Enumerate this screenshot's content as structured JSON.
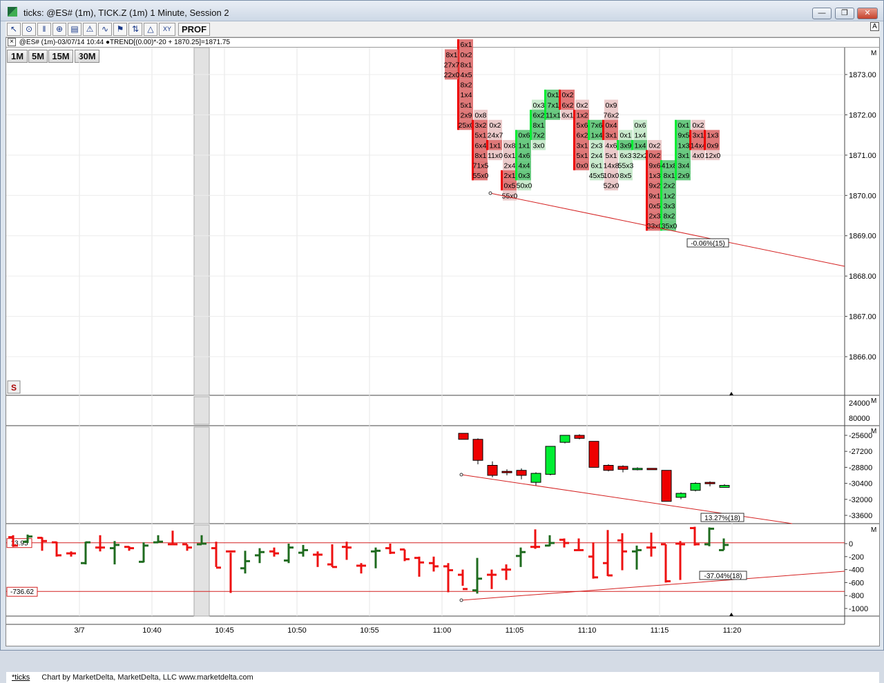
{
  "window": {
    "title": "ticks: @ES# (1m), TICK.Z (1m) 1 Minute, Session 2",
    "min_label": "—",
    "max_label": "❐",
    "close_label": "✕"
  },
  "toolbar": {
    "icons": [
      "cursor-icon",
      "crosshair-icon",
      "bars-icon",
      "zoom-icon",
      "chart-icon",
      "alert-icon",
      "study-icon",
      "flag-icon",
      "split-icon",
      "xy-icon"
    ],
    "prof_label": "PROF",
    "a_label": "A"
  },
  "infobar": {
    "text": "@ES# (1m)-03/07/14 10:44 ●TREND[(0.00)*-20 + 1870.25]=1871.75"
  },
  "timeframes": [
    "1M",
    "5M",
    "15M",
    "30M"
  ],
  "footer": {
    "link": "*ticks",
    "credit": "Chart by MarketDelta, MarketDelta, LLC www.marketdelta.com"
  },
  "colors": {
    "up": "#00ee33",
    "down": "#ee0000",
    "tick_up": "#1f6b1f",
    "tick_down": "#ee1111",
    "trend": "#d42020"
  },
  "chart_data": [
    {
      "type": "footprint",
      "title": "@ES# (1m)",
      "ylim": [
        1865,
        1873.75
      ],
      "yticks": [
        1866,
        1867,
        1868,
        1869,
        1870,
        1871,
        1872,
        1873
      ],
      "candles": [
        {
          "t": "11:01",
          "o": 1873.75,
          "c": 1871.75,
          "h": 1873.75,
          "l": 1871.75,
          "up": false,
          "cells": [
            [
              "6x1",
              1873.75
            ],
            [
              "8x1",
              "0x2",
              1873.5
            ],
            [
              "27x7",
              "8x1",
              1873.25
            ],
            [
              "22x0",
              "4x5",
              1873
            ],
            [
              "8x2",
              1872.75
            ],
            [
              "1x4",
              1872.5
            ],
            [
              "5x1",
              1872.25
            ],
            [
              "2x9",
              1872
            ],
            [
              "25x0",
              1871.75
            ]
          ]
        },
        {
          "t": "11:02",
          "o": 1871.75,
          "c": 1870.5,
          "h": 1872,
          "l": 1870.5,
          "up": false,
          "cells": [
            [
              "0x8",
              1872
            ],
            [
              "3x2",
              1871.75
            ],
            [
              "5x1",
              1871.5
            ],
            [
              "6x4",
              1871.25
            ],
            [
              "8x1",
              1871
            ],
            [
              "71x5",
              1870.75
            ],
            [
              "55x0",
              1870.5
            ]
          ]
        },
        {
          "t": "11:03",
          "o": 1871.25,
          "c": 1871.25,
          "h": 1871.5,
          "l": 1870.25,
          "up": false,
          "cells": [
            [
              "0x2",
              1871.75
            ],
            [
              "24x7",
              1871.5
            ],
            [
              "1x1",
              1871.25
            ],
            [
              "11x0",
              1871
            ]
          ]
        },
        {
          "t": "11:04",
          "o": 1870.5,
          "c": 1870.25,
          "h": 1871.25,
          "l": 1870,
          "up": false,
          "cells": [
            [
              "0x8",
              1871.25
            ],
            [
              "6x1",
              1871
            ],
            [
              "2x4",
              1870.75
            ],
            [
              "2x1",
              1870.5
            ],
            [
              "0x5",
              1870.25
            ],
            [
              "55x0",
              1870
            ]
          ]
        },
        {
          "t": "11:05",
          "o": 1870.5,
          "c": 1871.5,
          "h": 1871.5,
          "l": 1870.25,
          "up": true,
          "cells": [
            [
              "0x6",
              1871.5
            ],
            [
              "1x1",
              1871.25
            ],
            [
              "4x6",
              1871
            ],
            [
              "4x4",
              1870.75
            ],
            [
              "0x3",
              1870.5
            ],
            [
              "50x0",
              1870.25
            ]
          ]
        },
        {
          "t": "11:06",
          "o": 1871.5,
          "c": 1872,
          "h": 1872.25,
          "l": 1871.25,
          "up": true,
          "cells": [
            [
              "0x3",
              1872.25
            ],
            [
              "6x2",
              1872
            ],
            [
              "8x1",
              1871.75
            ],
            [
              "7x2",
              1871.5
            ],
            [
              "3x0",
              1871.25
            ]
          ]
        },
        {
          "t": "11:07",
          "o": 1872,
          "c": 1872.5,
          "h": 1872.5,
          "l": 1872,
          "up": true,
          "cells": [
            [
              "0x1",
              1872.5
            ],
            [
              "7x1",
              1872.25
            ],
            [
              "11x1",
              1872
            ]
          ]
        },
        {
          "t": "11:08",
          "o": 1872.5,
          "c": 1872.25,
          "h": 1872.5,
          "l": 1872,
          "up": false,
          "cells": [
            [
              "0x2",
              1872.5
            ],
            [
              "6x2",
              1872.25
            ],
            [
              "6x1",
              1872
            ]
          ]
        },
        {
          "t": "11:09",
          "o": 1872,
          "c": 1870.75,
          "h": 1872.25,
          "l": 1870.75,
          "up": false,
          "cells": [
            [
              "0x2",
              1872.25
            ],
            [
              "1x2",
              1872
            ],
            [
              "5x6",
              1871.75
            ],
            [
              "6x2",
              1871.5
            ],
            [
              "3x1",
              1871.25
            ],
            [
              "5x1",
              1871
            ],
            [
              "0x0",
              1870.75
            ]
          ]
        },
        {
          "t": "11:10",
          "o": 1871.5,
          "c": 1871.75,
          "h": 1871.75,
          "l": 1870.5,
          "up": true,
          "cells": [
            [
              "7x6",
              1871.75
            ],
            [
              "1x4",
              1871.5
            ],
            [
              "2x3",
              1871.25
            ],
            [
              "2x4",
              1871
            ],
            [
              "6x1",
              1870.75
            ],
            [
              "45x5",
              1870.5
            ]
          ]
        },
        {
          "t": "11:11",
          "o": 1871.75,
          "c": 1871.5,
          "h": 1872.25,
          "l": 1870.5,
          "up": false,
          "cells": [
            [
              "0x9",
              1872.25
            ],
            [
              "76x2",
              1872
            ],
            [
              "0x4",
              1871.75
            ],
            [
              "3x1",
              1871.5
            ],
            [
              "4x6",
              1871.25
            ],
            [
              "5x1",
              1871
            ],
            [
              "14x8",
              1870.75
            ],
            [
              "10x0",
              1870.5
            ],
            [
              "52x0",
              1870.25
            ]
          ]
        },
        {
          "t": "11:12",
          "o": 1871.25,
          "c": 1871.25,
          "h": 1871.5,
          "l": 1870.5,
          "up": true,
          "cells": [
            [
              "0x1",
              1871.5
            ],
            [
              "3x9",
              1871.25
            ],
            [
              "6x3",
              1871
            ],
            [
              "55x3",
              1870.75
            ],
            [
              "8x5",
              1870.5
            ]
          ]
        },
        {
          "t": "11:13",
          "o": 1871.25,
          "c": 1871.25,
          "h": 1871.75,
          "l": 1871,
          "up": true,
          "cells": [
            [
              "0x6",
              1871.75
            ],
            [
              "1x4",
              1871.5
            ],
            [
              "1x4",
              1871.25
            ],
            [
              "32x2",
              1871
            ]
          ]
        },
        {
          "t": "11:14",
          "o": 1871,
          "c": 1869.25,
          "h": 1871.25,
          "l": 1869.25,
          "up": false,
          "cells": [
            [
              "0x2",
              1871.25
            ],
            [
              "0x2",
              1871
            ],
            [
              "9x6",
              1870.75
            ],
            [
              "1x3",
              1870.5
            ],
            [
              "9x2",
              1870.25
            ],
            [
              "9x1",
              1870
            ],
            [
              "0x5",
              1869.75
            ],
            [
              "2x3",
              1869.5
            ],
            [
              "33x0",
              1869.25
            ]
          ]
        },
        {
          "t": "11:15",
          "o": 1869.25,
          "c": 1870.75,
          "h": 1870.75,
          "l": 1869.25,
          "up": true,
          "cells": [
            [
              "41x8",
              1870.75
            ],
            [
              "8x1",
              1870.5
            ],
            [
              "2x2",
              1870.25
            ],
            [
              "1x2",
              1870
            ],
            [
              "3x3",
              1869.75
            ],
            [
              "8x2",
              1869.5
            ],
            [
              "35x0",
              1869.25
            ]
          ]
        },
        {
          "t": "11:16",
          "o": 1870.5,
          "c": 1871.75,
          "h": 1871.75,
          "l": 1870.5,
          "up": true,
          "cells": [
            [
              "0x1",
              1871.75
            ],
            [
              "9x5",
              1871.5
            ],
            [
              "1x3",
              1871.25
            ],
            [
              "3x1",
              1871
            ],
            [
              "3x4",
              1870.75
            ],
            [
              "2x9",
              1870.5
            ]
          ]
        },
        {
          "t": "11:17",
          "o": 1871.5,
          "c": 1871.25,
          "h": 1871.75,
          "l": 1871,
          "up": false,
          "cells": [
            [
              "0x2",
              1871.75
            ],
            [
              "3x1",
              1871.5
            ],
            [
              "14x4",
              1871.25
            ],
            [
              "4x0",
              1871
            ]
          ]
        },
        {
          "t": "11:18",
          "o": 1871.5,
          "c": 1871.25,
          "h": 1871.5,
          "l": 1871,
          "up": false,
          "cells": [
            [
              "1x3",
              1871.5
            ],
            [
              "0x9",
              1871.25
            ],
            [
              "12x0",
              1871
            ]
          ]
        }
      ],
      "trend_label": "-0.06%(15)"
    },
    {
      "type": "bar",
      "name": "volume",
      "yticks": [
        "24000",
        "80000"
      ]
    },
    {
      "type": "candlestick",
      "yticks": [
        -25600,
        -27200,
        -28800,
        -30400,
        -32000,
        -33600
      ],
      "ylim": [
        -24900,
        -34200
      ],
      "candles": [
        [
          -25400,
          -26000,
          -25400,
          -26000
        ],
        [
          -26000,
          -28100,
          -25900,
          -28500
        ],
        [
          -28600,
          -29600,
          -28200,
          -29800
        ],
        [
          -29200,
          -29300,
          -29000,
          -29600
        ],
        [
          -29100,
          -29600,
          -28900,
          -30000
        ],
        [
          -30300,
          -29400,
          -29300,
          -30600
        ],
        [
          -29500,
          -26700,
          -26700,
          -29600
        ],
        [
          -26300,
          -25600,
          -25600,
          -26400
        ],
        [
          -25600,
          -25900,
          -25500,
          -26000
        ],
        [
          -26200,
          -28800,
          -26200,
          -28800
        ],
        [
          -28600,
          -29100,
          -28500,
          -29200
        ],
        [
          -28700,
          -29000,
          -28600,
          -29300
        ],
        [
          -29000,
          -28900,
          -28800,
          -29100
        ],
        [
          -28900,
          -29000,
          -28900,
          -29000
        ],
        [
          -29100,
          -32200,
          -29100,
          -32200
        ],
        [
          -31800,
          -31400,
          -31300,
          -32000
        ],
        [
          -31100,
          -30400,
          -30300,
          -31200
        ],
        [
          -30300,
          -30400,
          -30200,
          -30700
        ],
        [
          -30800,
          -30600,
          -30500,
          -30800
        ]
      ],
      "trend_label": "13.27%(18)"
    },
    {
      "type": "ohlc",
      "name": "TICK.Z (1m)",
      "yticks": [
        0,
        -200,
        -400,
        -600,
        -800,
        -1000
      ],
      "ylim": [
        150,
        -1130
      ],
      "label_high": "13.95",
      "label_low": "-736.62",
      "trend_label": "-37.04%(18)"
    }
  ],
  "xaxis": {
    "ticks": [
      "3/7",
      "10:40",
      "10:45",
      "10:50",
      "10:55",
      "11:00",
      "11:05",
      "11:10",
      "11:15",
      "11:20"
    ]
  }
}
